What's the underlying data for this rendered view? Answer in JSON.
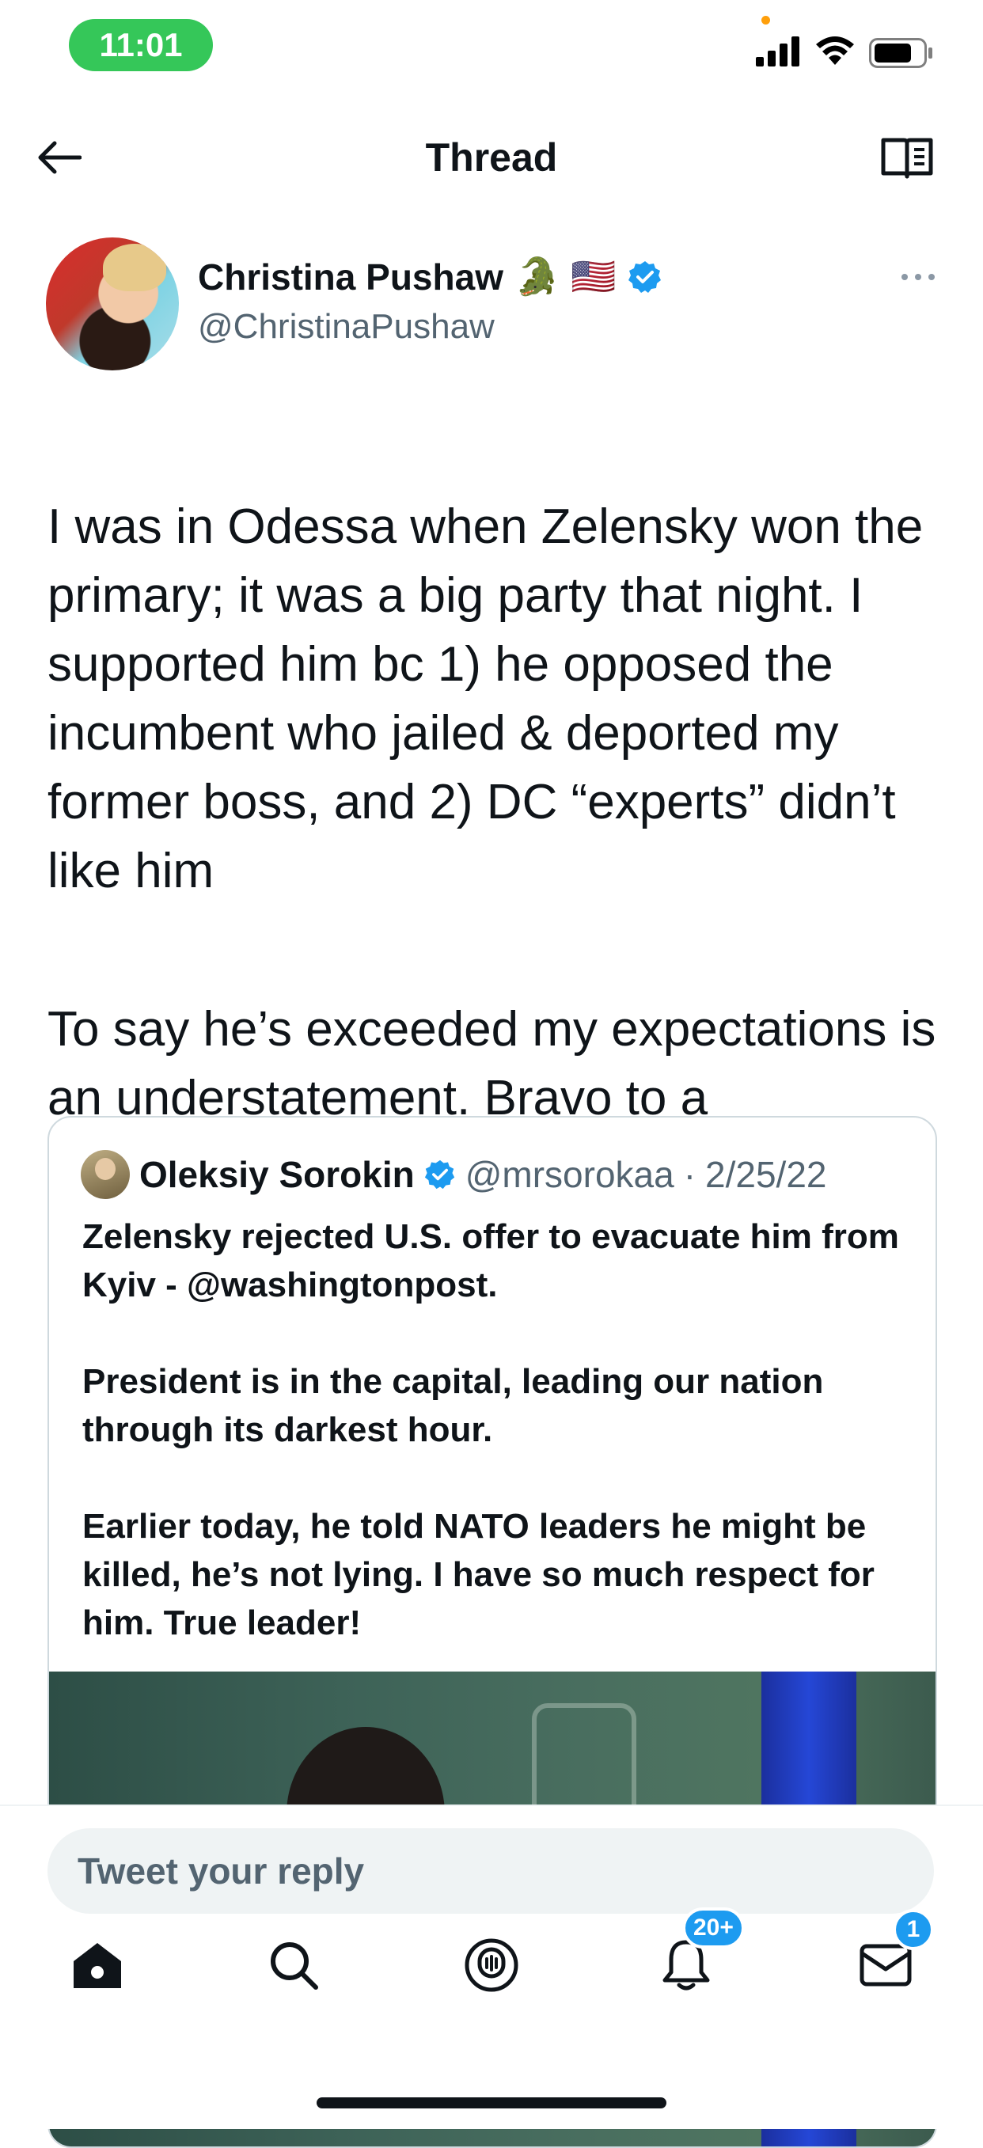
{
  "status_bar": {
    "time": "11:01"
  },
  "header": {
    "title": "Thread"
  },
  "tweet": {
    "author_name": "Christina Pushaw",
    "author_emoji": "🐊",
    "author_flag": "🇺🇸",
    "author_handle": "@ChristinaPushaw",
    "paragraphs": [
      "I was in Odessa when Zelensky won the primary; it was a big party that night. I supported him bc 1) he opposed the incumbent who jailed & deported my former boss, and 2) DC “experts” didn’t like him",
      "To say he’s exceeded my expectations is an understatement. Bravo to a statesman."
    ]
  },
  "quote": {
    "author_name": "Oleksiy Sorokin",
    "author_handle": "@mrsorokaa",
    "separator": "·",
    "date": "2/25/22",
    "paragraphs": [
      "Zelensky rejected U.S. offer to evacuate him from Kyiv - @washingtonpost.",
      "President is in the capital, leading our nation through its darkest hour.",
      "Earlier today, he told NATO leaders he might be killed, he’s not lying. I have so much respect for him. True leader!"
    ]
  },
  "reply": {
    "placeholder": "Tweet your reply"
  },
  "tabbar": {
    "notifications_badge": "20+",
    "messages_badge": "1"
  },
  "colors": {
    "accent": "#1d9bf0",
    "status_pill": "#35c759"
  }
}
